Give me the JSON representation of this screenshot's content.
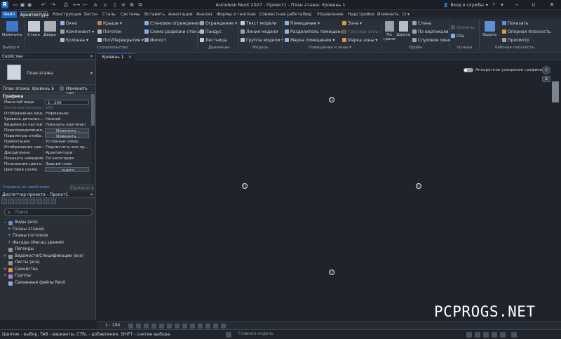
{
  "app": {
    "title": "Autodesk Revit 2027 - Проект1 - План этажа: Уровень 1",
    "signin": "Вход в службы",
    "logo_letter": "R",
    "accent": "#1b64b8"
  },
  "tabs": [
    "Файл",
    "Архитектура",
    "Конструкция",
    "Бетон",
    "Сталь",
    "Системы",
    "Вставить",
    "Аннотации",
    "Анализ",
    "Формы и генплан",
    "Совместная работа",
    "Вид",
    "Управление",
    "Надстройки",
    "Изменить",
    "⊡ ▾"
  ],
  "ribbon": {
    "select": {
      "modify": "Изменить",
      "label": "Выбор ▾"
    },
    "build": {
      "label": "Строительство",
      "wall": "Стена",
      "door": "Дверь",
      "window": "Окно",
      "component": "Компонент ▾",
      "column": "Колонна ▾",
      "roof": "Крыша ▾",
      "ceiling": "Потолок",
      "floor": "Пол/Перекрытие ▾",
      "curtain_system": "Стеновое ограждение",
      "curtain_grid": "Схема разрезки стены",
      "mullion": "Импост"
    },
    "circulation": {
      "label": "Движение",
      "railing": "Ограждение ▾",
      "ramp": "Пандус",
      "stair": "Лестница"
    },
    "model": {
      "label": "Модель",
      "text": "Текст модели",
      "line": "Линия модели",
      "group": "Группа модели ▾"
    },
    "rooms": {
      "label": "Помещения и зоны ▾",
      "room": "Помещение ▾",
      "separator": "Разделитель помещений",
      "tag_room": "Марка помещения ▾",
      "area": "Зона ▾",
      "area_boundary": "Граница зоны",
      "tag_area": "Марка зоны ▾"
    },
    "opening": {
      "label": "Проём",
      "by_face": "По грани",
      "shaft": "Шахта",
      "wall": "Стена",
      "vertical": "По вертикали",
      "dormer": "Слуховое окно"
    },
    "datum": {
      "label": "Основа",
      "level": "Уровень",
      "grid": "Ось"
    },
    "workplane": {
      "label": "Рабочая плоскость",
      "set": "Задать",
      "show": "Показать",
      "ref_plane": "Опорная плоскость",
      "viewer": "Просмотр"
    }
  },
  "properties": {
    "title": "Свойства",
    "type_name": "План этажа",
    "filter": "План этажа: Уровень 1",
    "edit_type": "Изменить тип",
    "group": "Графика",
    "rows": [
      {
        "k": "Масштаб вида",
        "v": "1 : 100",
        "style": "box"
      },
      {
        "k": "Значение масшта...",
        "v": "100",
        "style": "dim"
      },
      {
        "k": "Отображение мод...",
        "v": "Нормально"
      },
      {
        "k": "Уровень детализ...",
        "v": "Низкий"
      },
      {
        "k": "Видимость частей",
        "v": "Показать оригинал"
      },
      {
        "k": "Переопределения...",
        "v": "Изменить...",
        "style": "btn"
      },
      {
        "k": "Параметры отобр...",
        "v": "Изменить...",
        "style": "btn"
      },
      {
        "k": "Ориентация",
        "v": "Условный север"
      },
      {
        "k": "Отображение при...",
        "v": "Подчистить все пр..."
      },
      {
        "k": "Дисциплина",
        "v": "Архитектура"
      },
      {
        "k": "Показать невидим...",
        "v": "По категории"
      },
      {
        "k": "Положение цвето...",
        "v": "Задний план"
      },
      {
        "k": "Цветовая схема",
        "v": "<нет>",
        "style": "btn"
      }
    ],
    "help": "Справка по свойствам",
    "apply": "Применить"
  },
  "browser": {
    "title": "Диспетчер проекта - Проект1",
    "search_placeholder": "Поиск",
    "items": [
      {
        "label": "Виды (все)",
        "level": 0,
        "toggle": "−",
        "icon": "#5b8fd6"
      },
      {
        "label": "Планы этажей",
        "level": 1,
        "toggle": "+",
        "icon": ""
      },
      {
        "label": "Планы потолков",
        "level": 1,
        "toggle": "+",
        "icon": ""
      },
      {
        "label": "Фасады (Фасад здания)",
        "level": 1,
        "toggle": "+",
        "icon": ""
      },
      {
        "label": "Легенды",
        "level": 0,
        "toggle": "",
        "icon": "#8d949e"
      },
      {
        "label": "Ведомости/Спецификации (все)",
        "level": 0,
        "toggle": "+",
        "icon": "#8d949e"
      },
      {
        "label": "Листы (все)",
        "level": 0,
        "toggle": "",
        "icon": "#8d949e"
      },
      {
        "label": "Семейства",
        "level": 0,
        "toggle": "+",
        "icon": "#d59a3c"
      },
      {
        "label": "Группы",
        "level": 0,
        "toggle": "+",
        "icon": "#b07ad4"
      },
      {
        "label": "Связанные файлы Revit",
        "level": 0,
        "toggle": "",
        "icon": "#7fb0e6"
      }
    ]
  },
  "canvas": {
    "view_tab": "Уровень 1",
    "hw_accel": "Аппаратное ускорение графики",
    "elevation_marker": "○"
  },
  "viewbar": {
    "scale": "1 : 100"
  },
  "status": {
    "hint": "Щелчок - выбор, TAB - варианты, CTRL - добавление, SHIFT - снятие выбора.",
    "model": "Главная модель"
  },
  "watermark": "PCPROGS.NET"
}
